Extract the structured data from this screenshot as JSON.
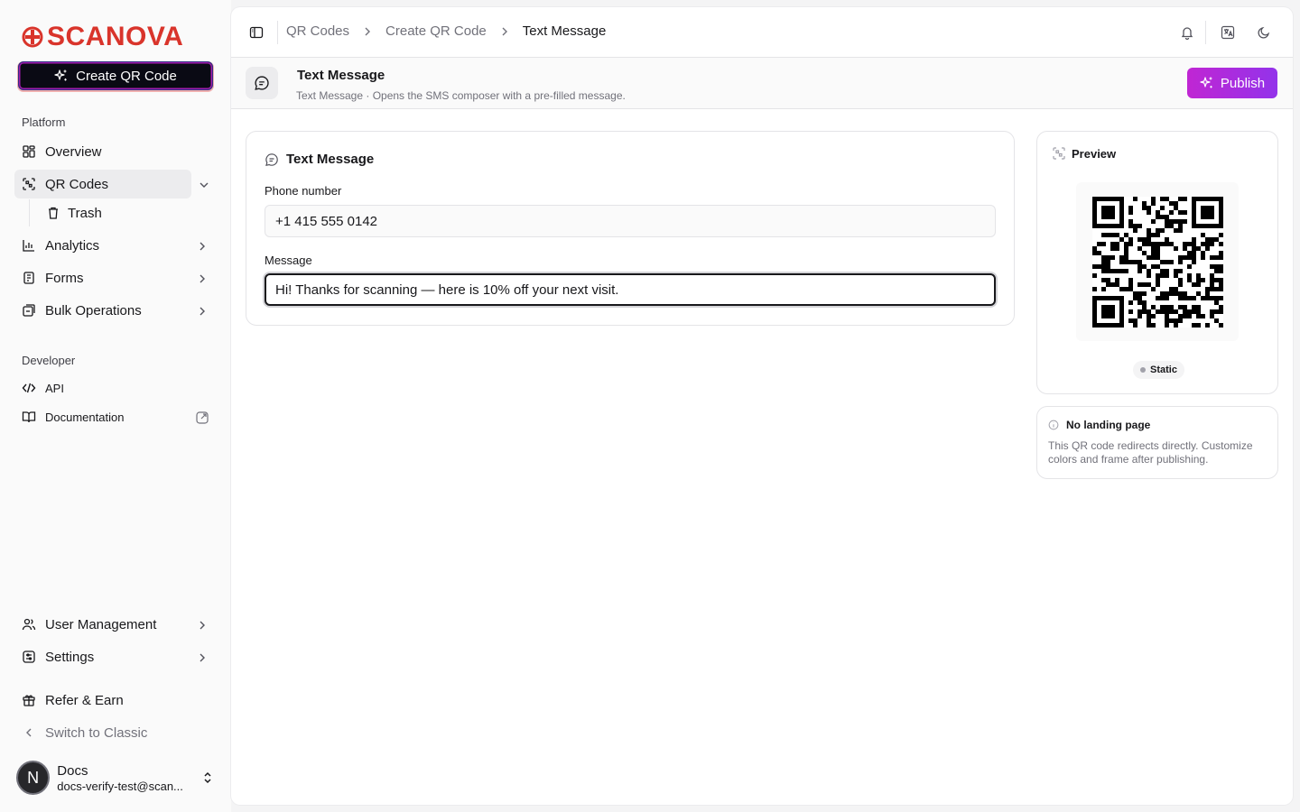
{
  "brand": {
    "name": "SCANOVA",
    "color": "#d9342b"
  },
  "sidebar": {
    "create_label": "Create QR Code",
    "platform_label": "Platform",
    "items": [
      {
        "label": "Overview",
        "icon": "grid-icon"
      },
      {
        "label": "QR Codes",
        "icon": "qr-scan-icon"
      },
      {
        "label": "Trash",
        "icon": "trash-icon"
      },
      {
        "label": "Analytics",
        "icon": "chart-icon"
      },
      {
        "label": "Forms",
        "icon": "form-icon"
      },
      {
        "label": "Bulk Operations",
        "icon": "layers-icon"
      }
    ],
    "developer_label": "Developer",
    "dev_items": [
      {
        "label": "API",
        "icon": "code-icon"
      },
      {
        "label": "Documentation",
        "icon": "book-icon"
      }
    ],
    "bottom_items": [
      {
        "label": "User Management",
        "icon": "users-icon"
      },
      {
        "label": "Settings",
        "icon": "settings-icon"
      },
      {
        "label": "Refer & Earn",
        "icon": "gift-icon"
      },
      {
        "label": "Switch to Classic",
        "icon": "chevron-left-icon"
      }
    ],
    "user": {
      "initial": "N",
      "name": "Docs",
      "email": "docs-verify-test@scan..."
    }
  },
  "breadcrumb": [
    "QR Codes",
    "Create QR Code",
    "Text Message"
  ],
  "header": {
    "title": "Text Message",
    "subtitle": "Text Message · Opens the SMS composer with a pre-filled message.",
    "publish_label": "Publish",
    "publish_color": "#c026d3"
  },
  "form": {
    "title": "Text Message",
    "phone_label": "Phone number",
    "phone_value": "+1 415 555 0142",
    "message_label": "Message",
    "message_value": "Hi! Thanks for scanning — here is 10% off your next visit."
  },
  "preview": {
    "title": "Preview",
    "badge": "Static"
  },
  "info": {
    "title": "No landing page",
    "text": "This QR code redirects directly. Customize colors and frame after publishing."
  }
}
